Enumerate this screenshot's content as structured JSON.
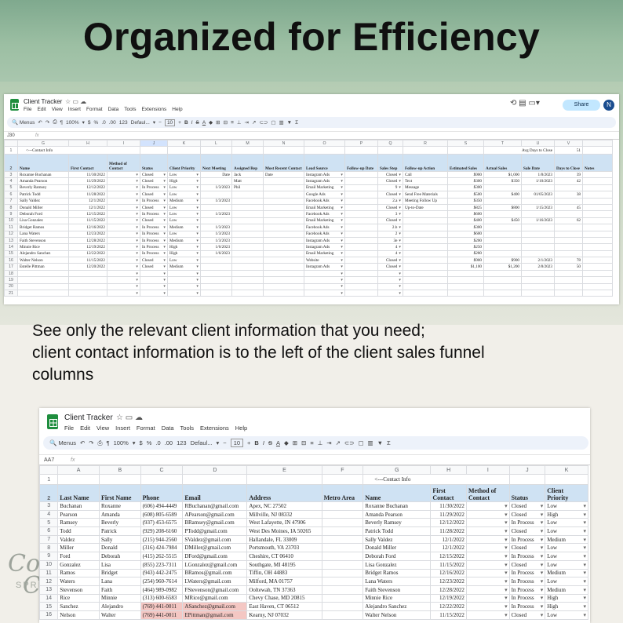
{
  "headline": "Organized for Efficiency",
  "caption": [
    "See only the relevant client information that you need;",
    "client contact information is to the left of the client sales funnel",
    "columns"
  ],
  "watermark": {
    "logo": "Cot\nCi",
    "sub": "SPRE"
  },
  "window": {
    "title": "Client Tracker",
    "menus": [
      "File",
      "Edit",
      "View",
      "Insert",
      "Format",
      "Data",
      "Tools",
      "Extensions",
      "Help"
    ],
    "share": "Share",
    "avatar": "N",
    "toolbar": {
      "menus": "Menus",
      "zoom": "100%",
      "currency": "$",
      "percent": "%",
      "dec_dec": ".0",
      "dec_inc": ".00",
      "num": "123",
      "font": "Defaul...",
      "size": "10"
    }
  },
  "shot1": {
    "cell_ref": "J30",
    "fx": "fx",
    "cols": [
      "G",
      "H",
      "I",
      "J",
      "K",
      "L",
      "M",
      "N",
      "O",
      "P",
      "Q",
      "R",
      "S",
      "T",
      "U",
      "V"
    ],
    "selected_col": "J",
    "row1": {
      "contact_info": "<---Contact Info",
      "avg_label": "Avg Days to Close",
      "avg_value": "51"
    },
    "headers": [
      "Name",
      "First Contact",
      "Method of Contact",
      "Status",
      "Client Priority",
      "Next Meeting",
      "Assigned Rep",
      "Most Recent Contact",
      "Lead Source",
      "Follow-up Date",
      "Sales Step",
      "Follow-up Action",
      "Estimated Sales",
      "Actual Sales",
      "Sale Date",
      "Days to Close",
      "Notes"
    ],
    "rows": [
      [
        "3",
        "Roxanne Buchanan",
        "11/30/2022",
        "",
        "Closed",
        "Low",
        "Date",
        "Jack",
        "Date",
        "Instagram Ads",
        "",
        "Closed",
        "Call",
        "$900",
        "$1,000",
        "1/8/2023",
        "39",
        ""
      ],
      [
        "4",
        "Amanda Pearson",
        "11/29/2022",
        "",
        "Closed",
        "High",
        "",
        "Matt",
        "",
        "Instagram Ads",
        "",
        "Closed",
        "Text",
        "$300",
        "$350",
        "1/10/2023",
        "42",
        ""
      ],
      [
        "5",
        "Beverly Ramsey",
        "12/12/2022",
        "",
        "In Process",
        "Low",
        "1/3/2023",
        "Phil",
        "",
        "Email Marketing",
        "",
        "9",
        "Message",
        "$300",
        "",
        "",
        "",
        ""
      ],
      [
        "6",
        "Patrick Todd",
        "11/28/2022",
        "",
        "Closed",
        "Low",
        "",
        "",
        "",
        "Google Ads",
        "",
        "Closed",
        "Send Free Materials",
        "$500",
        "$400",
        "01/05/2023",
        "38",
        ""
      ],
      [
        "7",
        "Sally Valdez",
        "12/1/2022",
        "",
        "In Process",
        "Medium",
        "1/3/2023",
        "",
        "",
        "Facebook Ads",
        "",
        "2.a",
        "Meeting Follow Up",
        "$350",
        "",
        "",
        "",
        ""
      ],
      [
        "8",
        "Donald Miller",
        "12/1/2022",
        "",
        "Closed",
        "Low",
        "",
        "",
        "",
        "Email Marketing",
        "",
        "Closed",
        "Up-to-Date",
        "$825",
        "$800",
        "1/15/2023",
        "45",
        ""
      ],
      [
        "9",
        "Deborah Ford",
        "12/15/2022",
        "",
        "In Process",
        "Low",
        "1/3/2023",
        "",
        "",
        "Facebook Ads",
        "",
        "3",
        "",
        "$600",
        "",
        "",
        "",
        ""
      ],
      [
        "10",
        "Lisa Gonzalez",
        "11/15/2022",
        "",
        "Closed",
        "Low",
        "",
        "",
        "",
        "Email Marketing",
        "",
        "Closed",
        "",
        "$400",
        "$450",
        "1/16/2023",
        "62",
        ""
      ],
      [
        "11",
        "Bridget Ramos",
        "12/16/2022",
        "",
        "In Process",
        "Medium",
        "1/3/2023",
        "",
        "",
        "Facebook Ads",
        "",
        "2.b",
        "",
        "$300",
        "",
        "",
        "",
        ""
      ],
      [
        "12",
        "Lana Waters",
        "12/23/2022",
        "",
        "In Process",
        "Low",
        "1/3/2023",
        "",
        "",
        "Facebook Ads",
        "",
        "2",
        "",
        "$600",
        "",
        "",
        "",
        ""
      ],
      [
        "13",
        "Faith Stevenson",
        "12/28/2022",
        "",
        "In Process",
        "Medium",
        "1/3/2023",
        "",
        "",
        "Instagram Ads",
        "",
        "3e",
        "",
        "$200",
        "",
        "",
        "",
        ""
      ],
      [
        "14",
        "Minnie Rice",
        "12/19/2022",
        "",
        "In Process",
        "High",
        "1/6/2023",
        "",
        "",
        "Instagram Ads",
        "",
        "4",
        "",
        "$250",
        "",
        "",
        "",
        ""
      ],
      [
        "15",
        "Alejandro Sanchez",
        "12/22/2022",
        "",
        "In Process",
        "High",
        "1/6/2023",
        "",
        "",
        "Email Marketing",
        "",
        "4",
        "",
        "$280",
        "",
        "",
        "",
        ""
      ],
      [
        "16",
        "Walter Nelson",
        "11/15/2022",
        "",
        "Closed",
        "Low",
        "",
        "",
        "",
        "Website",
        "",
        "Closed",
        "",
        "$900",
        "$900",
        "2/1/2023",
        "78",
        ""
      ],
      [
        "17",
        "Estelle Pittman",
        "12/20/2022",
        "",
        "Closed",
        "Medium",
        "",
        "",
        "",
        "Instagram Ads",
        "",
        "Closed",
        "",
        "$1,100",
        "$1,200",
        "2/8/2023",
        "50",
        ""
      ],
      [
        "18",
        "",
        "",
        "",
        "",
        "",
        "",
        "",
        "",
        "",
        "",
        "",
        "",
        "",
        "",
        "",
        "",
        ""
      ],
      [
        "19",
        "",
        "",
        "",
        "",
        "",
        "",
        "",
        "",
        "",
        "",
        "",
        "",
        "",
        "",
        "",
        "",
        ""
      ],
      [
        "20",
        "",
        "",
        "",
        "",
        "",
        "",
        "",
        "",
        "",
        "",
        "",
        "",
        "",
        "",
        "",
        "",
        ""
      ],
      [
        "21",
        "",
        "",
        "",
        "",
        "",
        "",
        "",
        "",
        "",
        "",
        "",
        "",
        "",
        "",
        "",
        "",
        ""
      ]
    ]
  },
  "shot2": {
    "cell_ref": "AA7",
    "fx": "fx",
    "cols": [
      "A",
      "B",
      "C",
      "D",
      "E",
      "F",
      "G",
      "H",
      "I",
      "J",
      "K"
    ],
    "row1": {
      "contact_info": "<---Contact Info"
    },
    "headers": [
      "Last Name",
      "First Name",
      "Phone",
      "Email",
      "Address",
      "Metro Area",
      "Name",
      "First Contact",
      "Method of Contact",
      "Status",
      "Client Priority"
    ],
    "rows": [
      [
        "3",
        "Buchanan",
        "Roxanne",
        "(606) 494-4449",
        "RBuchanan@gmail.com",
        "Apex, NC 27502",
        "",
        "Roxanne Buchanan",
        "11/30/2022",
        "",
        "Closed",
        "Low"
      ],
      [
        "4",
        "Pearson",
        "Amanda",
        "(608) 805-6589",
        "APearson@gmail.com",
        "Millville, NJ 08332",
        "",
        "Amanda Pearson",
        "11/29/2022",
        "",
        "Closed",
        "High"
      ],
      [
        "5",
        "Ramsey",
        "Beverly",
        "(937) 453-6575",
        "BRamsey@gmail.com",
        "West Lafayette, IN 47906",
        "",
        "Beverly Ramsey",
        "12/12/2022",
        "",
        "In Process",
        "Low"
      ],
      [
        "6",
        "Todd",
        "Patrick",
        "(929) 208-6160",
        "PTodd@gmail.com",
        "West Des Moines, IA 50265",
        "",
        "Patrick Todd",
        "11/28/2022",
        "",
        "Closed",
        "Low"
      ],
      [
        "7",
        "Valdez",
        "Sally",
        "(215) 944-2560",
        "SValdez@gmail.com",
        "Hallandale, FL 33009",
        "",
        "Sally Valdez",
        "12/1/2022",
        "",
        "In Process",
        "Medium"
      ],
      [
        "8",
        "Miller",
        "Donald",
        "(316) 424-7984",
        "DMiller@gmail.com",
        "Portsmouth, VA 23703",
        "",
        "Donald Miller",
        "12/1/2022",
        "",
        "Closed",
        "Low"
      ],
      [
        "9",
        "Ford",
        "Deborah",
        "(415) 262-5515",
        "DFord@gmail.com",
        "Cheshire, CT 06410",
        "",
        "Deborah Ford",
        "12/15/2022",
        "",
        "In Process",
        "Low"
      ],
      [
        "10",
        "Gonzalez",
        "Lisa",
        "(855) 223-7311",
        "LGonzalez@gmail.com",
        "Southgate, MI 48195",
        "",
        "Lisa Gonzalez",
        "11/15/2022",
        "",
        "Closed",
        "Low"
      ],
      [
        "11",
        "Ramos",
        "Bridget",
        "(943) 442-2475",
        "BRamos@gmail.com",
        "Tiffin, OH 44883",
        "",
        "Bridget Ramos",
        "12/16/2022",
        "",
        "In Process",
        "Medium"
      ],
      [
        "12",
        "Waters",
        "Lana",
        "(254) 960-7614",
        "LWaters@gmail.com",
        "Milford, MA 01757",
        "",
        "Lana Waters",
        "12/23/2022",
        "",
        "In Process",
        "Low"
      ],
      [
        "13",
        "Stevenson",
        "Faith",
        "(464) 989-0982",
        "FStevenson@gmail.com",
        "Ooltewah, TN 37363",
        "",
        "Faith Stevenson",
        "12/28/2022",
        "",
        "In Process",
        "Medium"
      ],
      [
        "14",
        "Rice",
        "Minnie",
        "(313) 600-6583",
        "MRice@gmail.com",
        "Chevy Chase, MD 20815",
        "",
        "Minnie Rice",
        "12/19/2022",
        "",
        "In Process",
        "High"
      ],
      [
        "15",
        "Sanchez",
        "Alejandro",
        "(769) 441-0011",
        "ASanchez@gmail.com",
        "East Haven, CT 06512",
        "",
        "Alejandro Sanchez",
        "12/22/2022",
        "",
        "In Process",
        "High"
      ],
      [
        "16",
        "Nelson",
        "Walter",
        "(769) 441-0011",
        "EPittman@gmail.com",
        "Kearny, NJ 07032",
        "",
        "Walter Nelson",
        "11/15/2022",
        "",
        "Closed",
        "Low"
      ]
    ]
  },
  "colors": {
    "header_fill": "#cfe2f3",
    "selected_col": "#d3e3fd",
    "duplicate_highlight": "#f4c7c3",
    "sheets_green": "#1e8e3e"
  }
}
